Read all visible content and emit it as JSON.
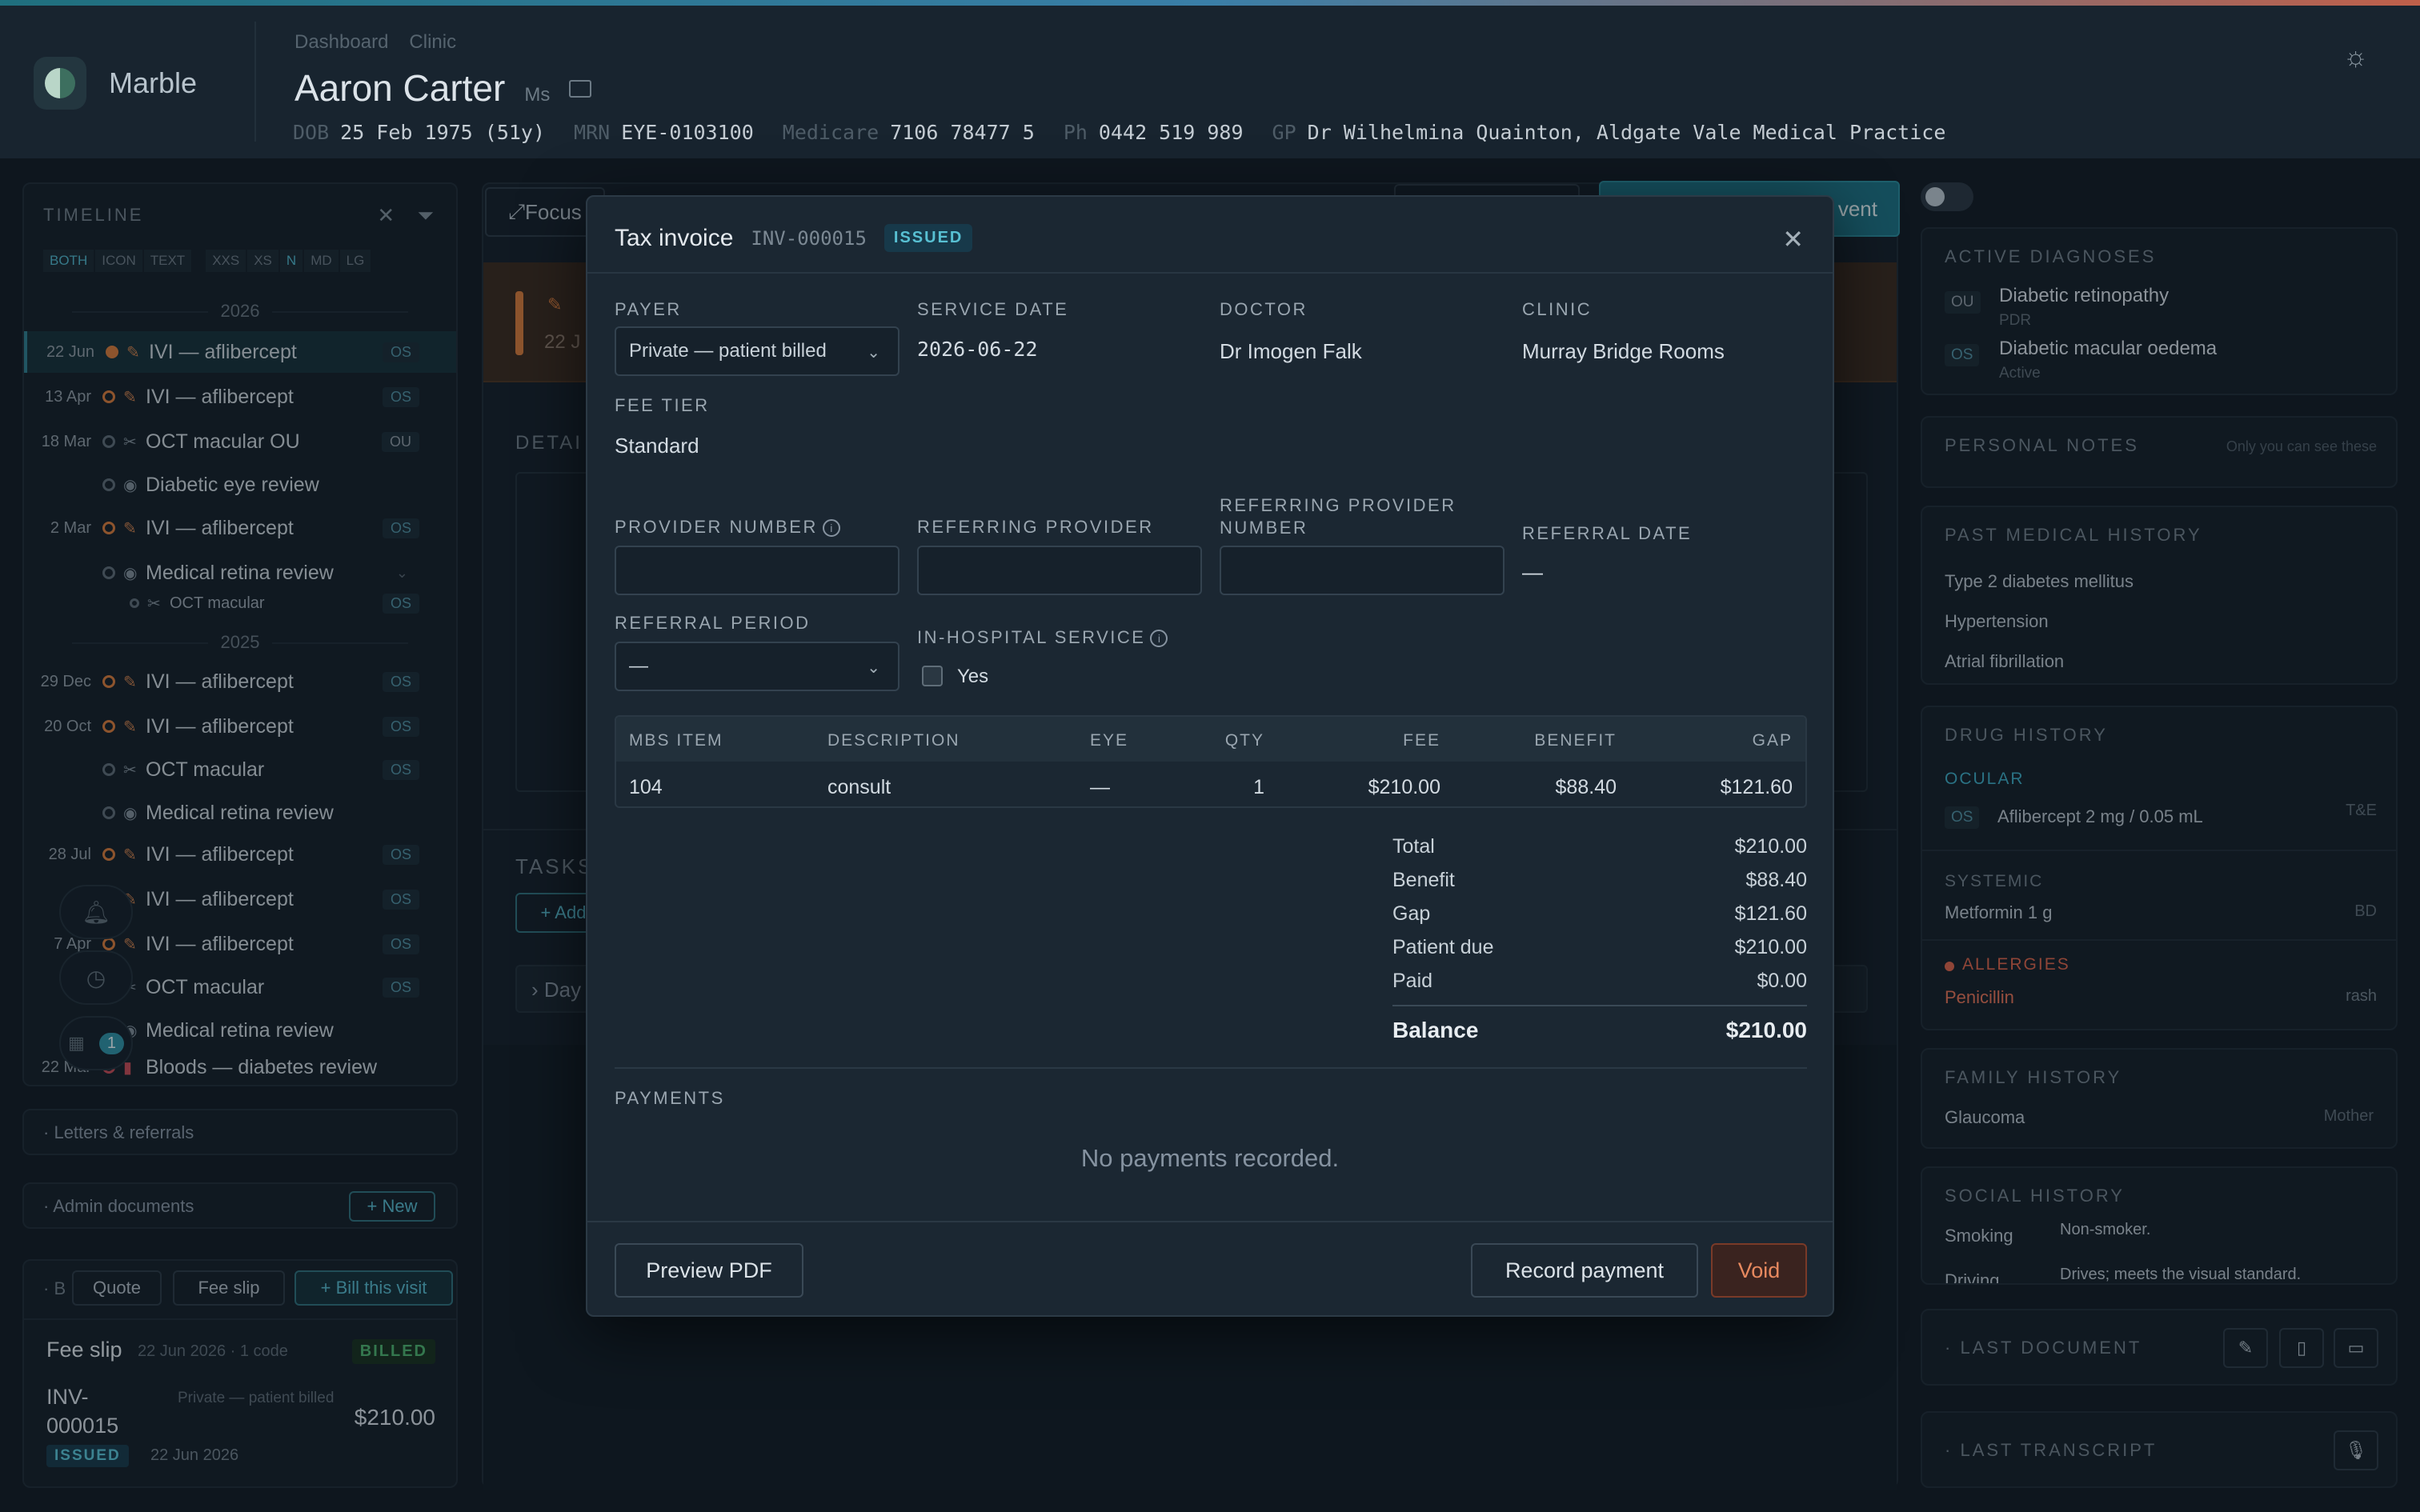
{
  "app": {
    "brand": "Marble"
  },
  "breadcrumbs": [
    "Dashboard",
    "Clinic"
  ],
  "patient": {
    "name": "Aaron Carter",
    "title": "Ms",
    "dob_label": "DOB",
    "dob": "25 Feb 1975 (51y)",
    "mrn_label": "MRN",
    "mrn": "EYE-0103100",
    "medicare_label": "Medicare",
    "medicare": "7106 78477 5",
    "ph_label": "Ph",
    "ph": "0442 519 989",
    "gp_label": "GP",
    "gp": "Dr Wilhelmina Quainton, Aldgate Vale Medical Practice"
  },
  "timeline": {
    "title": "TIMELINE",
    "chips": [
      "BOTH",
      "ICON",
      "TEXT",
      "XXS",
      "XS",
      "N",
      "MD",
      "LG"
    ],
    "years": [
      "2026",
      "2025"
    ],
    "events": [
      {
        "date": "22 Jun",
        "label": "IVI — aflibercept",
        "eye": "OS"
      },
      {
        "date": "13 Apr",
        "label": "IVI — aflibercept",
        "eye": "OS"
      },
      {
        "date": "18 Mar",
        "label": "OCT macular OU",
        "eye": "OU"
      },
      {
        "date": "",
        "label": "Diabetic eye review",
        "eye": ""
      },
      {
        "date": "2 Mar",
        "label": "IVI — aflibercept",
        "eye": "OS"
      },
      {
        "date": "",
        "label": "Medical retina review",
        "eye": ""
      },
      {
        "date": "",
        "label": "OCT macular",
        "eye": "OS"
      },
      {
        "date": "29 Dec",
        "label": "IVI — aflibercept",
        "eye": "OS"
      },
      {
        "date": "20 Oct",
        "label": "IVI — aflibercept",
        "eye": "OS"
      },
      {
        "date": "",
        "label": "OCT macular",
        "eye": "OS"
      },
      {
        "date": "",
        "label": "Medical retina review",
        "eye": ""
      },
      {
        "date": "28 Jul",
        "label": "IVI — aflibercept",
        "eye": "OS"
      },
      {
        "date": "",
        "label": "IVI — aflibercept",
        "eye": "OS"
      },
      {
        "date": "7 Apr",
        "label": "IVI — aflibercept",
        "eye": "OS"
      },
      {
        "date": "",
        "label": "OCT macular",
        "eye": "OS"
      },
      {
        "date": "",
        "label": "Medical retina review",
        "eye": ""
      },
      {
        "date": "22 Mar",
        "label": "Bloods — diabetes review",
        "eye": ""
      }
    ],
    "notif_count": "1"
  },
  "left_panels": {
    "letters": "Letters & referrals",
    "admin": "Admin documents",
    "new_btn": "+ New",
    "billing_prefix": "B",
    "quote_btn": "Quote",
    "feeslip_btn": "Fee slip",
    "bill_btn": "+ Bill this visit",
    "fee_slip_title": "Fee slip",
    "fee_slip_meta": "22 Jun 2026 · 1 code",
    "fee_slip_status": "BILLED",
    "inv_no": "INV-000015",
    "inv_payer": "Private — patient billed",
    "inv_amount": "$210.00",
    "inv_status": "ISSUED",
    "inv_date": "22 Jun 2026"
  },
  "main": {
    "focus_btn": "Focus",
    "event_btn_tail": "vent",
    "row_date": "22 J",
    "details": "DETAI",
    "tasks": "TASKS",
    "add_btn": "+ Add",
    "day_row": "Day"
  },
  "right": {
    "active_dx_title": "ACTIVE DIAGNOSES",
    "dx": [
      {
        "eye": "OU",
        "name": "Diabetic retinopathy",
        "sub": "PDR"
      },
      {
        "eye": "OS",
        "name": "Diabetic macular oedema",
        "sub": "Active"
      }
    ],
    "notes_title": "PERSONAL NOTES",
    "notes_hint": "Only you can see these",
    "pmh_title": "PAST MEDICAL HISTORY",
    "pmh": [
      "Type 2 diabetes mellitus",
      "Hypertension",
      "Atrial fibrillation"
    ],
    "drug_title": "DRUG HISTORY",
    "ocular_label": "OCULAR",
    "ocular_eye": "OS",
    "ocular_drug": "Aflibercept 2 mg / 0.05 mL",
    "ocular_freq": "T&E",
    "systemic_label": "SYSTEMIC",
    "systemic_drug": "Metformin 1 g",
    "systemic_freq": "BD",
    "allergies_label": "ALLERGIES",
    "allergy": "Penicillin",
    "allergy_reaction": "rash",
    "family_title": "FAMILY HISTORY",
    "family_condition": "Glaucoma",
    "family_relation": "Mother",
    "social_title": "SOCIAL HISTORY",
    "smoking_label": "Smoking",
    "smoking_value": "Non-smoker.",
    "driving_label": "Driving",
    "driving_value": "Drives; meets the visual standard.",
    "last_doc": "LAST DOCUMENT",
    "last_transcript": "LAST TRANSCRIPT"
  },
  "modal": {
    "title": "Tax invoice",
    "invoice_no": "INV-000015",
    "status": "ISSUED",
    "payer_label": "PAYER",
    "payer_value": "Private — patient billed",
    "service_date_label": "SERVICE DATE",
    "service_date": "2026-06-22",
    "doctor_label": "DOCTOR",
    "doctor": "Dr Imogen Falk",
    "clinic_label": "CLINIC",
    "clinic": "Murray Bridge Rooms",
    "fee_tier_label": "FEE TIER",
    "fee_tier": "Standard",
    "provider_number_label": "PROVIDER NUMBER",
    "referring_provider_label": "REFERRING PROVIDER",
    "referring_provider_number_label": "REFERRING PROVIDER NUMBER",
    "referral_date_label": "REFERRAL DATE",
    "referral_date": "—",
    "referral_period_label": "REFERRAL PERIOD",
    "referral_period": "—",
    "in_hospital_label": "IN-HOSPITAL SERVICE",
    "in_hospital_yes": "Yes",
    "table": {
      "headers": [
        "MBS ITEM",
        "DESCRIPTION",
        "EYE",
        "QTY",
        "FEE",
        "BENEFIT",
        "GAP"
      ],
      "rows": [
        [
          "104",
          "consult",
          "—",
          "1",
          "$210.00",
          "$88.40",
          "$121.60"
        ]
      ]
    },
    "totals": {
      "total_label": "Total",
      "total": "$210.00",
      "benefit_label": "Benefit",
      "benefit": "$88.40",
      "gap_label": "Gap",
      "gap": "$121.60",
      "patient_due_label": "Patient due",
      "patient_due": "$210.00",
      "paid_label": "Paid",
      "paid": "$0.00",
      "balance_label": "Balance",
      "balance": "$210.00"
    },
    "payments_label": "PAYMENTS",
    "payments_empty": "No payments recorded.",
    "preview_btn": "Preview PDF",
    "record_btn": "Record payment",
    "void_btn": "Void"
  },
  "colors": {
    "accent": "#2e8fa3",
    "danger": "#d8634a",
    "issued": "#58c0d3",
    "billed": "#4caf6e"
  }
}
